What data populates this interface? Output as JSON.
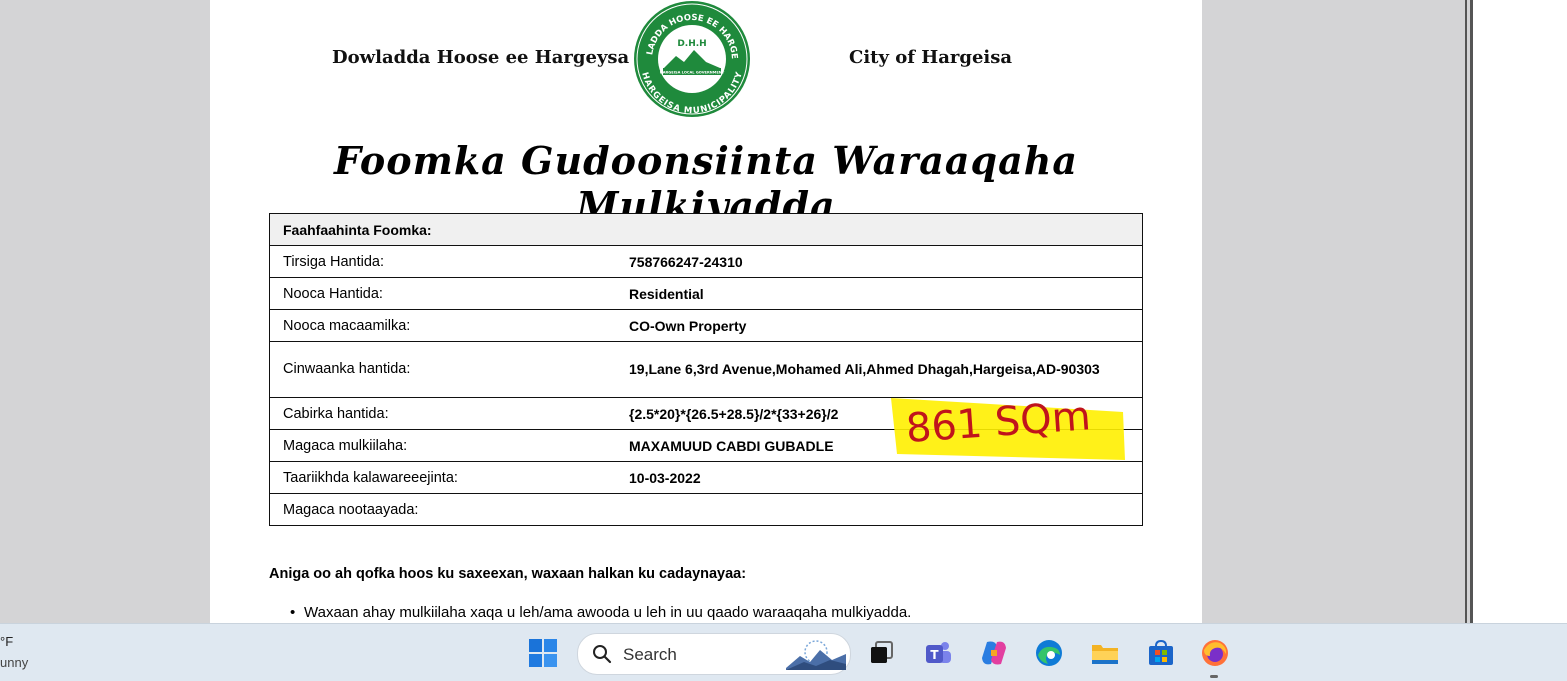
{
  "document": {
    "header_left": "Dowladda Hoose ee Hargeysa",
    "header_right": "City of Hargeisa",
    "seal": {
      "top_arc": "DAWLADDA HOOSE EE HARGEYSA",
      "bottom_arc": "HARGEISA MUNICIPALITY",
      "center": "D.H.H",
      "ribbon": "HARGEISA LOCAL GOVERNMENT"
    },
    "title": "Foomka Gudoonsiinta Waraaqaha Mulkiyadda",
    "table": {
      "heading": "Faahfaahinta Foomka:",
      "rows": [
        {
          "label": "Tirsiga Hantida:",
          "value": "758766247-24310"
        },
        {
          "label": "Nooca Hantida:",
          "value": "Residential"
        },
        {
          "label": "Nooca macaamilka:",
          "value": "CO-Own Property"
        },
        {
          "label": "Cinwaanka hantida:",
          "value": "19,Lane 6,3rd Avenue,Mohamed Ali,Ahmed Dhagah,Hargeisa,AD-90303"
        },
        {
          "label": "Cabirka hantida:",
          "value": "{2.5*20}*{26.5+28.5}/2*{33+26}/2"
        },
        {
          "label": "Magaca mulkiilaha:",
          "value": "MAXAMUUD CABDI GUBADLE"
        },
        {
          "label": "Taariikhda kalawareeejinta:",
          "value": "10-03-2022"
        },
        {
          "label": "Magaca nootaayada:",
          "value": ""
        }
      ]
    },
    "annotation": "861 SQm",
    "highlight_color": "#ffef00",
    "ink_color": "#c0141c",
    "declaration": "Aniga oo ah qofka hoos ku saxeexan, waxaan halkan ku cadaynayaa:",
    "bullet_1": "Waxaan ahay mulkiilaha xaqa u leh/ama awooda u leh in uu qaado waraaqaha mulkiyadda."
  },
  "taskbar": {
    "weather_temp": "°F",
    "weather_desc": "unny",
    "search_placeholder": "Search",
    "apps": [
      "windows-start",
      "search",
      "task-view",
      "teams",
      "copilot",
      "edge",
      "file-explorer",
      "microsoft-store",
      "firefox"
    ]
  },
  "colors": {
    "seal_green": "#1f8a3c",
    "taskbar_bg": "#dfe8f1",
    "viewer_bg": "#d4d4d6"
  }
}
